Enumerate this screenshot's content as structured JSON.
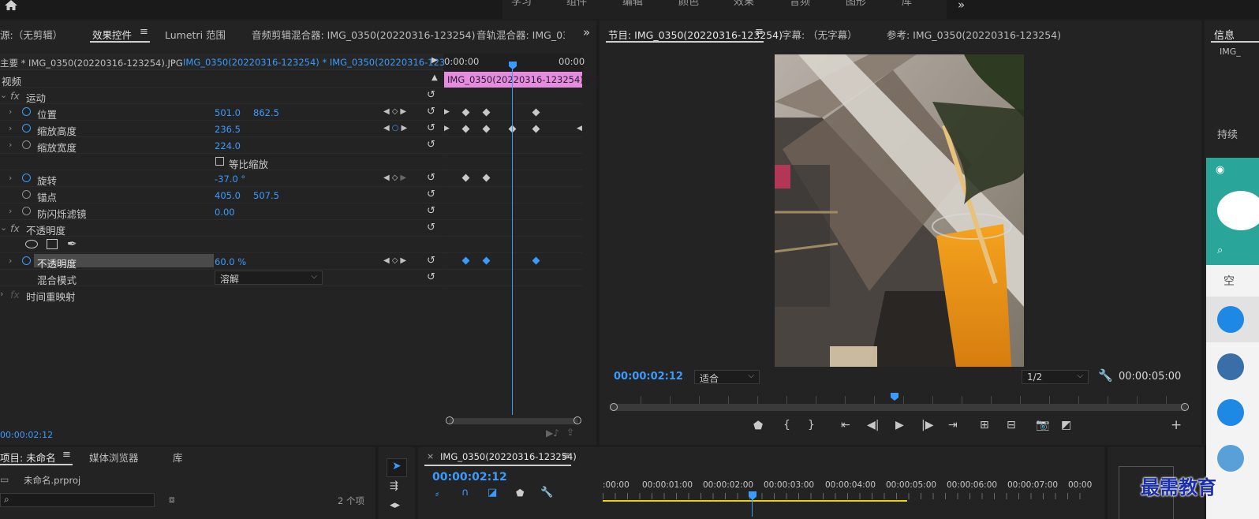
{
  "workspace_tabs": [
    "学习",
    "组件",
    "编辑",
    "颜色",
    "效果",
    "音频",
    "图形",
    "库"
  ],
  "effect_panel": {
    "tabs": [
      "源:（无剪辑）",
      "效果控件",
      "Lumetri 范围",
      "音频剪辑混合器: IMG_0350(20220316-123254)",
      "音轨混合器: IMG_03"
    ],
    "master_clip": "主要 * IMG_0350(20220316-123254).JPG",
    "seq_clip": "IMG_0350(20220316-123254) * IMG_0350(20220316-12325...",
    "mini_ruler": [
      "0:00:00",
      "00:00"
    ],
    "clip_bar": "IMG_0350(20220316-123254).JPG",
    "section_video": "视频",
    "motion": "运动",
    "rows": [
      {
        "label": "位置",
        "v1": "501.0",
        "v2": "862.5"
      },
      {
        "label": "缩放高度",
        "v1": "236.5",
        "v2": ""
      },
      {
        "label": "缩放宽度",
        "v1": "224.0",
        "v2": ""
      },
      {
        "label": "等比缩放",
        "v1": "",
        "v2": ""
      },
      {
        "label": "旋转",
        "v1": "-37.0 °",
        "v2": ""
      },
      {
        "label": "锚点",
        "v1": "405.0",
        "v2": "507.5"
      },
      {
        "label": "防闪烁滤镜",
        "v1": "0.00",
        "v2": ""
      }
    ],
    "opacity_section": "不透明度",
    "opacity_row": {
      "label": "不透明度",
      "value": "60.0 %"
    },
    "blend_label": "混合模式",
    "blend_value": "溶解",
    "time_remap": "时间重映射",
    "timecode": "00:00:02:12"
  },
  "program_panel": {
    "tabs": [
      "节目: IMG_0350(20220316-123254)",
      "字幕: （无字幕）",
      "参考: IMG_0350(20220316-123254)"
    ],
    "timecode": "00:00:02:12",
    "fit": "适合",
    "resolution": "1/2",
    "duration": "00:00:05:00"
  },
  "info_panel": {
    "title": "信息",
    "clip": "IMG_",
    "duration_label": "持续",
    "chat_empty": "空"
  },
  "project_panel": {
    "tabs": [
      "项目: 未命名",
      "媒体浏览器",
      "库"
    ],
    "file": "未命名.prproj",
    "count": "2 个项"
  },
  "timeline_panel": {
    "seq_name": "IMG_0350(20220316-123254)",
    "timecode": "00:00:02:12",
    "ruler": [
      ":00:00",
      "00:00:01:00",
      "00:00:02:00",
      "00:00:03:00",
      "00:00:04:00",
      "00:00:05:00",
      "00:00:06:00",
      "00:00:07:00",
      "00:00:0"
    ]
  },
  "watermark": "最需教育",
  "colors": {
    "accent": "#3a9bff",
    "clip_pink": "#e58be0",
    "panel_bg": "#232323",
    "yellow": "#e8d400"
  }
}
